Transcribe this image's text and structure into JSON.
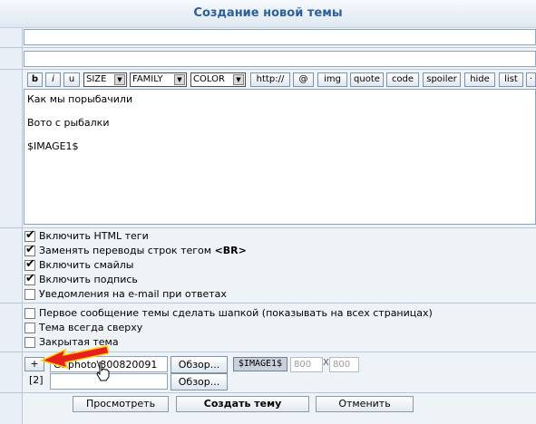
{
  "header": {
    "title": "Создание новой темы"
  },
  "toolbar": {
    "bold": "b",
    "italic": "i",
    "underline": "u",
    "size": "SIZE",
    "family": "FAMILY",
    "color": "COLOR",
    "http": "http://",
    "at": "@",
    "img": "img",
    "quote": "quote",
    "code": "code",
    "spoiler": "spoiler",
    "hide": "hide",
    "list": "list",
    "more": "·"
  },
  "editor": {
    "line1": "Как мы порыбачили",
    "line2": "Вото с рыбалки",
    "line3": "$IMAGE1$"
  },
  "options": [
    {
      "label": "Включить HTML теги",
      "checked": true
    },
    {
      "label_prefix": "Заменять переводы строк тегом ",
      "label_bold": "<BR>",
      "checked": true
    },
    {
      "label": "Включить смайлы",
      "checked": true
    },
    {
      "label": "Включить подпись",
      "checked": true
    },
    {
      "label": "Уведомления на e-mail при ответах",
      "checked": false
    },
    {
      "label": "Первое сообщение темы сделать шапкой (показывать на всех страницах)",
      "checked": false
    },
    {
      "label": "Тема всегда сверху",
      "checked": false
    },
    {
      "label": "Закрытая тема",
      "checked": false
    }
  ],
  "attachment": {
    "add": "+",
    "file_value": "G:\\photo\\300820091",
    "browse": "Обзор...",
    "tag": "$IMAGE1$",
    "width": "800",
    "times": "X",
    "height": "800",
    "index2": "[2]",
    "browse2": "Обзор..."
  },
  "buttons": {
    "preview": "Просмотреть",
    "create": "Создать тему",
    "cancel": "Отменить"
  },
  "colors": {
    "accent": "#2c5f9b",
    "arrow": "#e8201c"
  }
}
